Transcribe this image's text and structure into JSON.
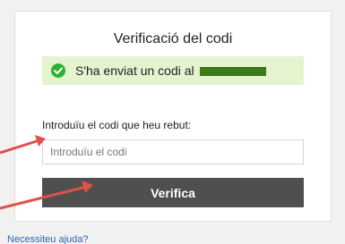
{
  "card": {
    "title": "Verificació del codi"
  },
  "notice": {
    "icon": "check-circle-icon",
    "text": "S'ha enviat un codi al",
    "color": "#e3f4cf",
    "icon_color": "#2fb12f",
    "redaction_color": "#3d7a18"
  },
  "form": {
    "code_label": "Introduïu el codi que heu rebut:",
    "code_placeholder": "Introduïu el codi",
    "verify_label": "Verifica",
    "button_color": "#4f4f4f"
  },
  "footer": {
    "help_link": "Necessiteu ajuda?",
    "link_color": "#2f66b3"
  },
  "annotations": {
    "arrow_color": "#df5149",
    "arrows": [
      {
        "name": "arrow-to-code-input",
        "icon": "arrow-right-icon"
      },
      {
        "name": "arrow-to-verify-button",
        "icon": "arrow-up-right-icon"
      }
    ]
  }
}
